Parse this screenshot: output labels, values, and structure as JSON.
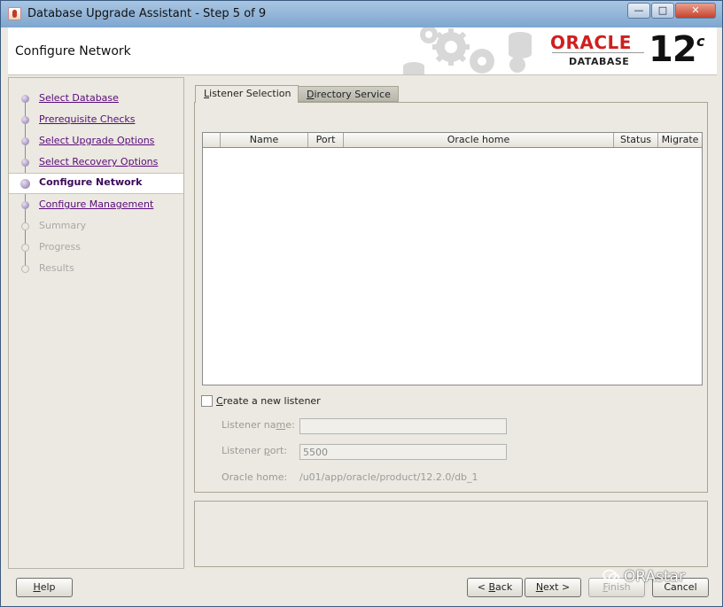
{
  "window": {
    "title": "Database Upgrade Assistant - Step 5 of 9",
    "min_glyph": "—",
    "max_glyph": "□",
    "close_glyph": "✕"
  },
  "header": {
    "page_title": "Configure Network",
    "logo_brand": "ORACLE",
    "logo_product": "DATABASE",
    "logo_version": "12",
    "logo_suffix": "c"
  },
  "steps": [
    {
      "label": "Select Database",
      "state": "done"
    },
    {
      "label": "Prerequisite Checks",
      "state": "done"
    },
    {
      "label": "Select Upgrade Options",
      "state": "done"
    },
    {
      "label": "Select Recovery Options",
      "state": "done"
    },
    {
      "label": "Configure Network",
      "state": "current"
    },
    {
      "label": "Configure Management",
      "state": "done"
    },
    {
      "label": "Summary",
      "state": "future"
    },
    {
      "label": "Progress",
      "state": "future"
    },
    {
      "label": "Results",
      "state": "future"
    }
  ],
  "tabs": {
    "listener_mn": "L",
    "listener_rest": "istener Selection",
    "directory_mn": "D",
    "directory_rest": "irectory Service"
  },
  "table": {
    "columns": [
      "",
      "Name",
      "Port",
      "Oracle home",
      "Status",
      "Migrate"
    ]
  },
  "new_listener": {
    "mn": "C",
    "rest": "reate a new listener",
    "checked": false
  },
  "fields": {
    "name_a": "Listener na",
    "name_mn": "m",
    "name_b": "e:",
    "name_value": "",
    "port_a": "Listener ",
    "port_mn": "p",
    "port_b": "ort:",
    "port_value": "5500",
    "home_label": "Oracle home:",
    "home_value": "/u01/app/oracle/product/12.2.0/db_1"
  },
  "buttons": {
    "help_mn": "H",
    "help_rest": "elp",
    "back_pre": "< ",
    "back_mn": "B",
    "back_rest": "ack",
    "next_mn": "N",
    "next_rest": "ext >",
    "finish_mn": "F",
    "finish_rest": "inish",
    "cancel": "Cancel"
  },
  "watermark": {
    "text": "ORAstar"
  }
}
